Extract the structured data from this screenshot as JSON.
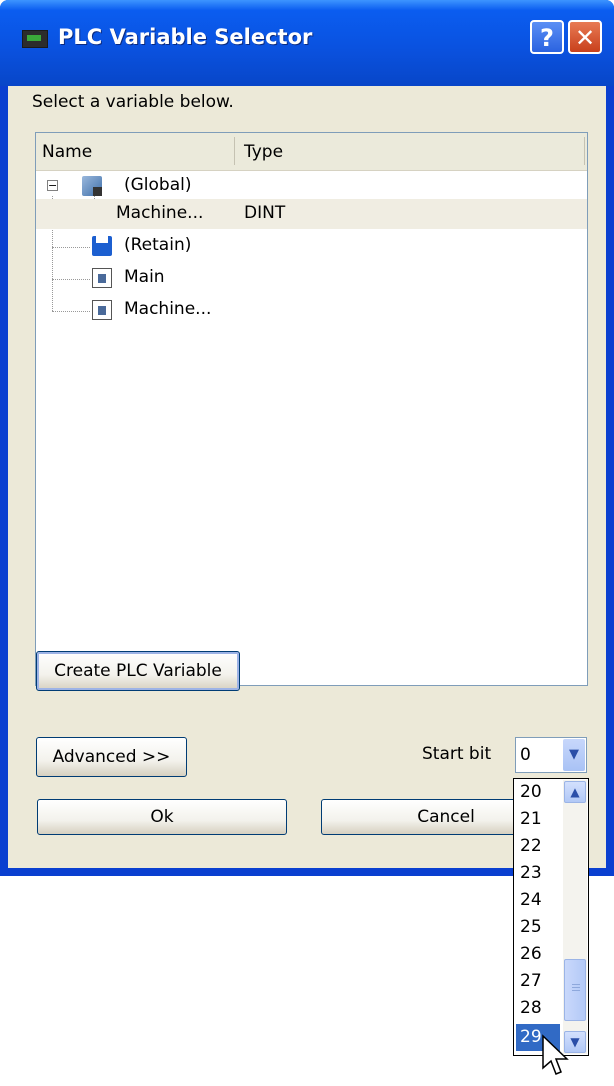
{
  "window": {
    "title": "PLC Variable Selector",
    "help_label": "?",
    "close_label": "✕"
  },
  "instruction": "Select a variable below.",
  "tree": {
    "columns": {
      "name": "Name",
      "type": "Type"
    },
    "expander_label": "−",
    "items": [
      {
        "label": "(Global)",
        "type": "",
        "icon": "global-folder-icon"
      },
      {
        "label": "Machine...",
        "type": "DINT",
        "icon": "none"
      },
      {
        "label": "(Retain)",
        "type": "",
        "icon": "floppy-icon"
      },
      {
        "label": "Main",
        "type": "",
        "icon": "document-icon"
      },
      {
        "label": "Machine...",
        "type": "",
        "icon": "document-icon"
      }
    ]
  },
  "buttons": {
    "create": "Create PLC Variable",
    "advanced": "Advanced >>",
    "ok": "Ok",
    "cancel": "Cancel"
  },
  "start_bit": {
    "label": "Start bit",
    "value": "0",
    "options": [
      "20",
      "21",
      "22",
      "23",
      "24",
      "25",
      "26",
      "27",
      "28",
      "29"
    ],
    "highlighted": "29"
  },
  "colors": {
    "title_bar": "#0a52e0",
    "dialog_bg": "#ece9d8",
    "selection": "#316ac5"
  }
}
